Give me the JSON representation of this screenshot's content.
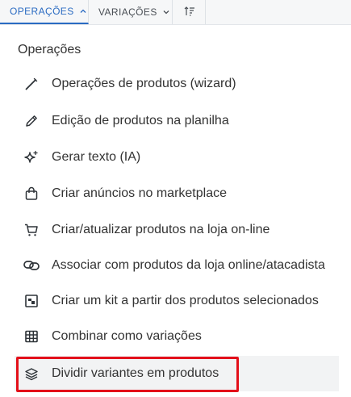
{
  "toolbar": {
    "operations_label": "OPERAÇÕES",
    "variations_label": "VARIAÇÕES",
    "sort_icon": "sort-icon"
  },
  "menu": {
    "heading": "Operações",
    "items": [
      {
        "label": "Operações de produtos (wizard)",
        "icon": "wand-icon"
      },
      {
        "label": "Edição de produtos na planilha",
        "icon": "pencil-icon"
      },
      {
        "label": "Gerar texto (IA)",
        "icon": "sparkles-icon"
      },
      {
        "label": "Criar anúncios no marketplace",
        "icon": "shopping-bag-icon"
      },
      {
        "label": "Criar/atualizar produtos na loja on-line",
        "icon": "cart-icon"
      },
      {
        "label": "Associar com produtos da loja online/atacadista",
        "icon": "link-icon"
      },
      {
        "label": "Criar um kit a partir dos produtos selecionados",
        "icon": "kit-icon"
      },
      {
        "label": "Combinar como variações",
        "icon": "grid-icon"
      },
      {
        "label": "Dividir variantes em produtos",
        "icon": "layers-icon"
      }
    ]
  },
  "colors": {
    "accent": "#2a6bc2",
    "highlight_border": "#e3101a"
  }
}
